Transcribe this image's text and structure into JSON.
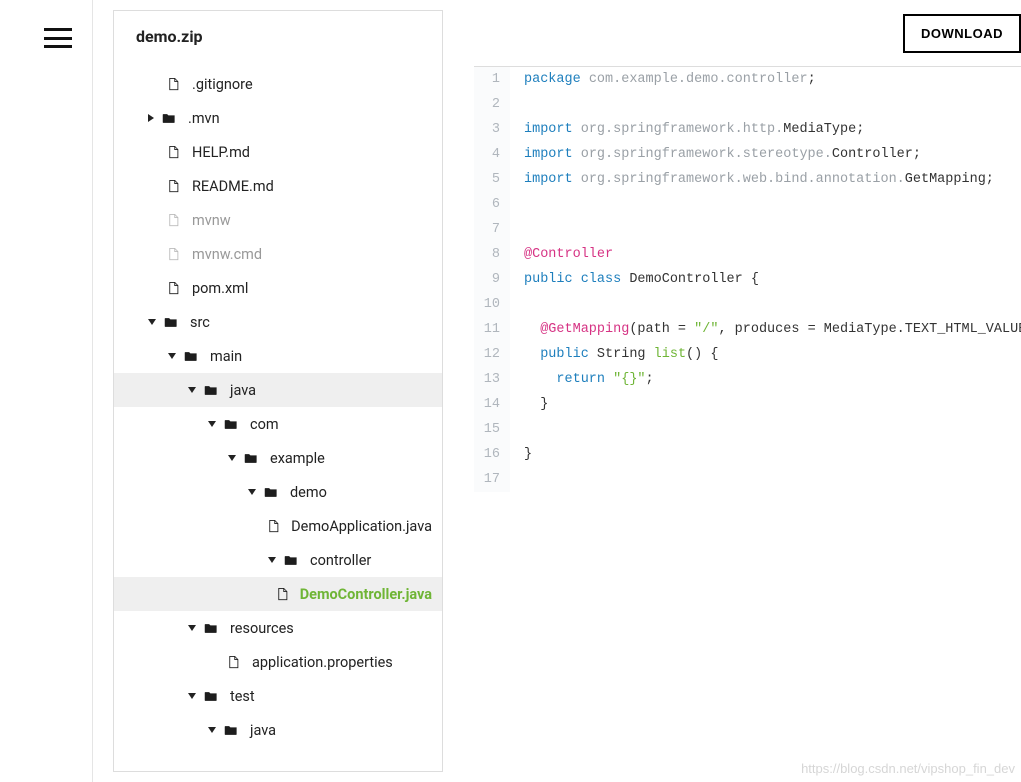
{
  "header": {
    "archive_name": "demo.zip",
    "download_label": "DOWNLOAD"
  },
  "tree": [
    {
      "kind": "file",
      "name": ".gitignore",
      "depth": 0,
      "caret": "none"
    },
    {
      "kind": "folder",
      "name": ".mvn",
      "depth": 0,
      "caret": "right"
    },
    {
      "kind": "file",
      "name": "HELP.md",
      "depth": 0,
      "caret": "none"
    },
    {
      "kind": "file",
      "name": "README.md",
      "depth": 0,
      "caret": "none"
    },
    {
      "kind": "file",
      "name": "mvnw",
      "depth": 0,
      "caret": "none",
      "muted": true
    },
    {
      "kind": "file",
      "name": "mvnw.cmd",
      "depth": 0,
      "caret": "none",
      "muted": true
    },
    {
      "kind": "file",
      "name": "pom.xml",
      "depth": 0,
      "caret": "none"
    },
    {
      "kind": "folder",
      "name": "src",
      "depth": 0,
      "caret": "down"
    },
    {
      "kind": "folder",
      "name": "main",
      "depth": 1,
      "caret": "down"
    },
    {
      "kind": "folder",
      "name": "java",
      "depth": 2,
      "caret": "down",
      "selFolder": true
    },
    {
      "kind": "folder",
      "name": "com",
      "depth": 3,
      "caret": "down"
    },
    {
      "kind": "folder",
      "name": "example",
      "depth": 4,
      "caret": "down"
    },
    {
      "kind": "folder",
      "name": "demo",
      "depth": 5,
      "caret": "down"
    },
    {
      "kind": "file",
      "name": "DemoApplication.java",
      "depth": 6,
      "caret": "none"
    },
    {
      "kind": "folder",
      "name": "controller",
      "depth": 6,
      "caret": "down"
    },
    {
      "kind": "file",
      "name": "DemoController.java",
      "depth": 7,
      "caret": "none",
      "selFile": true
    },
    {
      "kind": "folder",
      "name": "resources",
      "depth": 2,
      "caret": "down"
    },
    {
      "kind": "file",
      "name": "application.properties",
      "depth": 3,
      "caret": "none"
    },
    {
      "kind": "folder",
      "name": "test",
      "depth": 2,
      "caret": "down"
    },
    {
      "kind": "folder",
      "name": "java",
      "depth": 3,
      "caret": "down"
    }
  ],
  "code": {
    "lines": [
      [
        {
          "t": "package ",
          "c": "kw"
        },
        {
          "t": "com.example.demo.controller",
          "c": "pkg-path"
        },
        {
          "t": ";",
          "c": ""
        }
      ],
      [],
      [
        {
          "t": "import ",
          "c": "kw"
        },
        {
          "t": "org.springframework.http.",
          "c": "pkg-path"
        },
        {
          "t": "MediaType",
          "c": "cls"
        },
        {
          "t": ";",
          "c": ""
        }
      ],
      [
        {
          "t": "import ",
          "c": "kw"
        },
        {
          "t": "org.springframework.stereotype.",
          "c": "pkg-path"
        },
        {
          "t": "Controller",
          "c": "cls"
        },
        {
          "t": ";",
          "c": ""
        }
      ],
      [
        {
          "t": "import ",
          "c": "kw"
        },
        {
          "t": "org.springframework.web.bind.annotation.",
          "c": "pkg-path"
        },
        {
          "t": "GetMapping",
          "c": "cls"
        },
        {
          "t": ";",
          "c": ""
        }
      ],
      [],
      [],
      [
        {
          "t": "@Controller",
          "c": "ann"
        }
      ],
      [
        {
          "t": "public class ",
          "c": "kw"
        },
        {
          "t": "DemoController {",
          "c": "cls"
        }
      ],
      [],
      [
        {
          "t": "  ",
          "c": ""
        },
        {
          "t": "@GetMapping",
          "c": "ann"
        },
        {
          "t": "(path = ",
          "c": ""
        },
        {
          "t": "\"/\"",
          "c": "str"
        },
        {
          "t": ", produces = MediaType.TEXT_HTML_VALUE)",
          "c": ""
        }
      ],
      [
        {
          "t": "  ",
          "c": ""
        },
        {
          "t": "public ",
          "c": "kw"
        },
        {
          "t": "String ",
          "c": "cls"
        },
        {
          "t": "list",
          "c": "ident"
        },
        {
          "t": "() {",
          "c": ""
        }
      ],
      [
        {
          "t": "    ",
          "c": ""
        },
        {
          "t": "return ",
          "c": "kw"
        },
        {
          "t": "\"{}\"",
          "c": "str"
        },
        {
          "t": ";",
          "c": ""
        }
      ],
      [
        {
          "t": "  }",
          "c": ""
        }
      ],
      [],
      [
        {
          "t": "}",
          "c": ""
        }
      ],
      []
    ]
  },
  "watermark": "https://blog.csdn.net/vipshop_fin_dev"
}
